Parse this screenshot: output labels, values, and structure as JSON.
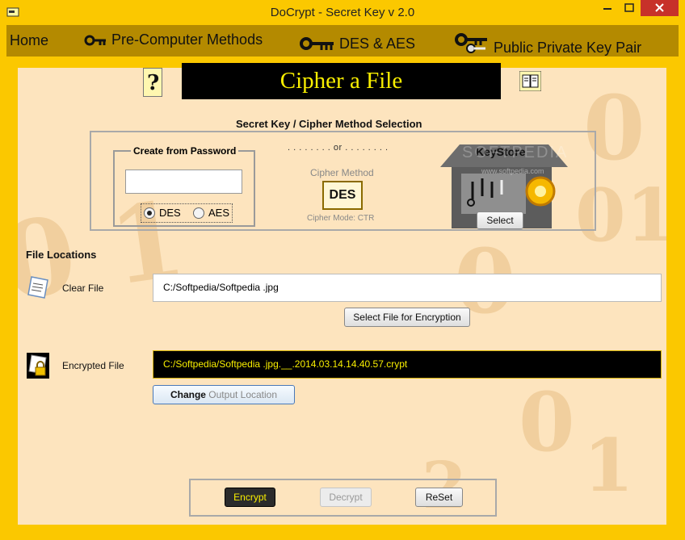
{
  "window": {
    "title": "DoCrypt - Secret Key v 2.0"
  },
  "menu": {
    "home": "Home",
    "pre_computer": "Pre-Computer Methods",
    "des_aes": "DES & AES",
    "public_private": "Public Private Key Pair"
  },
  "page": {
    "title": "Cipher a File"
  },
  "selection": {
    "title": "Secret Key / Cipher Method Selection",
    "create_from_password": "Create from Password",
    "password_value": "",
    "or_text": ". . . . . . . . or . . . . . . . .",
    "cipher_method_label": "Cipher Method",
    "cipher_method_value": "DES",
    "cipher_mode": "Cipher Mode: CTR",
    "radio_des": "DES",
    "radio_aes": "AES",
    "selected_radio": "DES"
  },
  "keystore": {
    "label": "KeyStore",
    "select_label": "Select",
    "watermark": "SOFTPEDIA",
    "watermark_url": "www.softpedia.com"
  },
  "files": {
    "section_title": "File Locations",
    "clear_label": "Clear File",
    "clear_path": "C:/Softpedia/Softpedia .jpg",
    "select_button": "Select File for Encryption",
    "encrypted_label": "Encrypted File",
    "encrypted_path": "C:/Softpedia/Softpedia .jpg.__.2014.03.14.14.40.57.crypt",
    "change_bold": "Change",
    "change_rest": " Output Location"
  },
  "actions": {
    "encrypt": "Encrypt",
    "decrypt": "Decrypt",
    "reset": "ReSet"
  },
  "colors": {
    "frame": "#fbc800",
    "menubar": "#b48a00",
    "panel": "#fde4be",
    "banner_bg": "#000000",
    "banner_text": "#f8ee00",
    "close": "#c7312a"
  }
}
